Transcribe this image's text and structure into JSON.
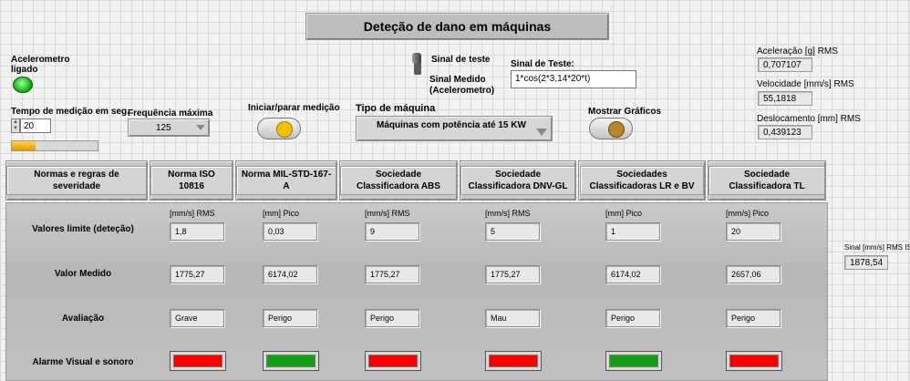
{
  "title": "Deteção de dano em máquinas",
  "led": {
    "label": "Acelerometro ligado",
    "color": "#16b516"
  },
  "tempo": {
    "label": "Tempo de medição em seg.",
    "value": "20",
    "progress": 0.28
  },
  "frequencia": {
    "label": "Frequência máxima",
    "value": "125"
  },
  "iniciar": {
    "label": "Iniciar/parar medição",
    "lamp_color": "#f2c200"
  },
  "toggle": {
    "label_top": "Sinal de teste",
    "label_bottom": "Sinal Medido (Acelerometro)"
  },
  "sinal_teste": {
    "label": "Sinal de Teste:",
    "value": "1*cos(2*3,14*20*t)"
  },
  "tipo_maquina": {
    "label": "Tipo de máquina",
    "value": "Máquinas com potência até 15 KW"
  },
  "mostrar": {
    "label": "Mostrar Gráficos",
    "lamp_color": "#b8862a"
  },
  "readouts": [
    {
      "label": "Aceleração [g] RMS",
      "value": "0,707107"
    },
    {
      "label": "Velocidade [mm/s] RMS",
      "value": "55,1818"
    },
    {
      "label": "Deslocamento [mm] RMS",
      "value": "0,439123"
    }
  ],
  "sinal_rms": {
    "label": "Sinal [mm/s] RMS ISO",
    "value": "1878,54"
  },
  "table": {
    "corner": "Normas e regras de severidade",
    "columns": [
      "Norma ISO 10816",
      "Norma MIL-STD-167-A",
      "Sociedade Classificadora ABS",
      "Sociedade Classificadora DNV-GL",
      "Sociedades Classificadoras LR e BV",
      "Sociedade Classificadora TL"
    ],
    "row_labels": {
      "limite": "Valores limite (deteção)",
      "medido": "Valor Medido",
      "avaliacao": "Avaliação",
      "alarme": "Alarme Visual e sonoro"
    },
    "units": [
      "[mm/s] RMS",
      "[mm] Pico",
      "[mm/s] RMS",
      "[mm/s] RMS",
      "[mm] Pico",
      "[mm/s] Pico"
    ],
    "limits": [
      "1,8",
      "0,03",
      "9",
      "5",
      "1",
      "20"
    ],
    "measured": [
      "1775,27",
      "6174,02",
      "1775,27",
      "1775,27",
      "6174,02",
      "2657,06"
    ],
    "evaluation": [
      "Grave",
      "Perigo",
      "Perigo",
      "Mau",
      "Perigo",
      "Perigo"
    ],
    "alarm_colors": [
      "#ff0000",
      "#14a014",
      "#ff0000",
      "#ff0000",
      "#14a014",
      "#ff0000"
    ]
  }
}
